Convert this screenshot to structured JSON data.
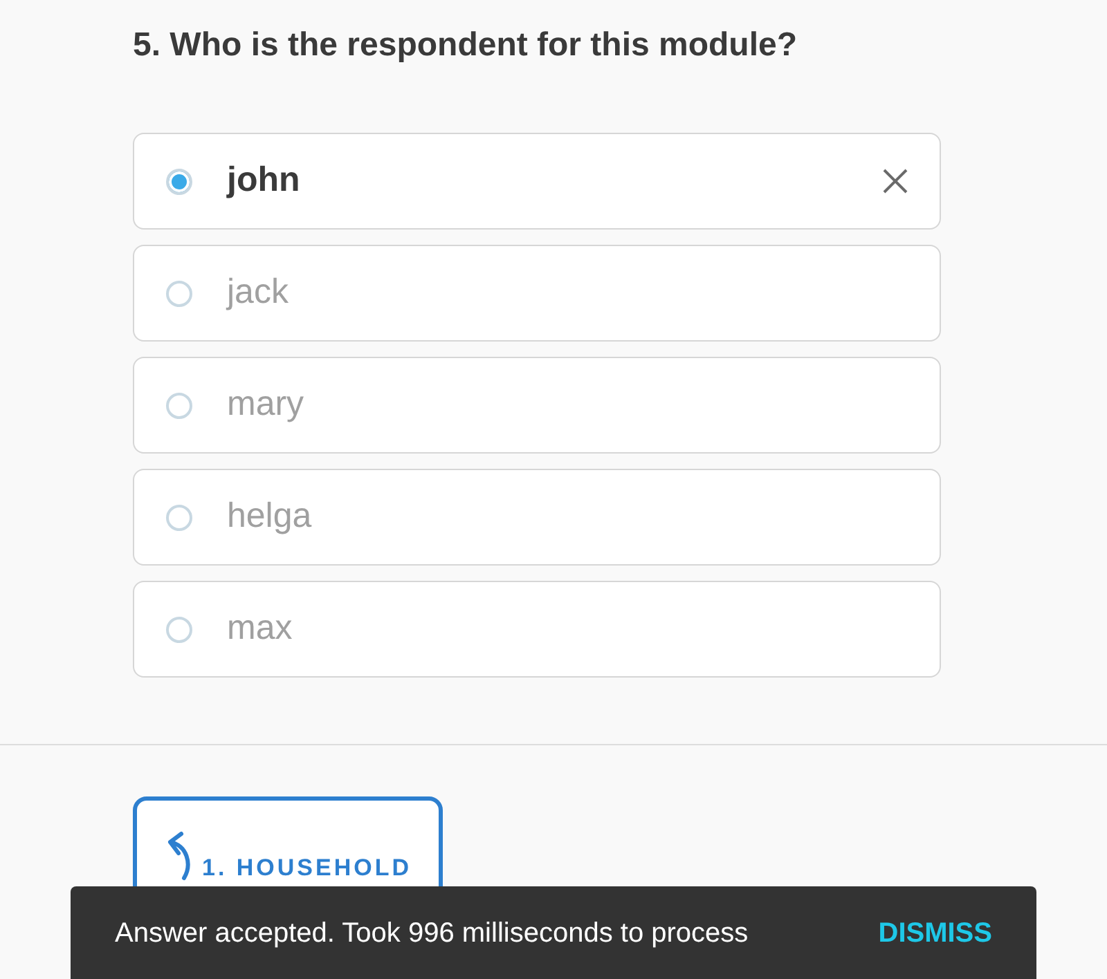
{
  "question": "5. Who is the respondent for this module?",
  "options": [
    {
      "label": "john",
      "selected": true
    },
    {
      "label": "jack",
      "selected": false
    },
    {
      "label": "mary",
      "selected": false
    },
    {
      "label": "helga",
      "selected": false
    },
    {
      "label": "max",
      "selected": false
    }
  ],
  "back_button": {
    "label": "1. HOUSEHOLD"
  },
  "snackbar": {
    "message": "Answer accepted. Took 996 milliseconds to process",
    "action": "DISMISS"
  }
}
